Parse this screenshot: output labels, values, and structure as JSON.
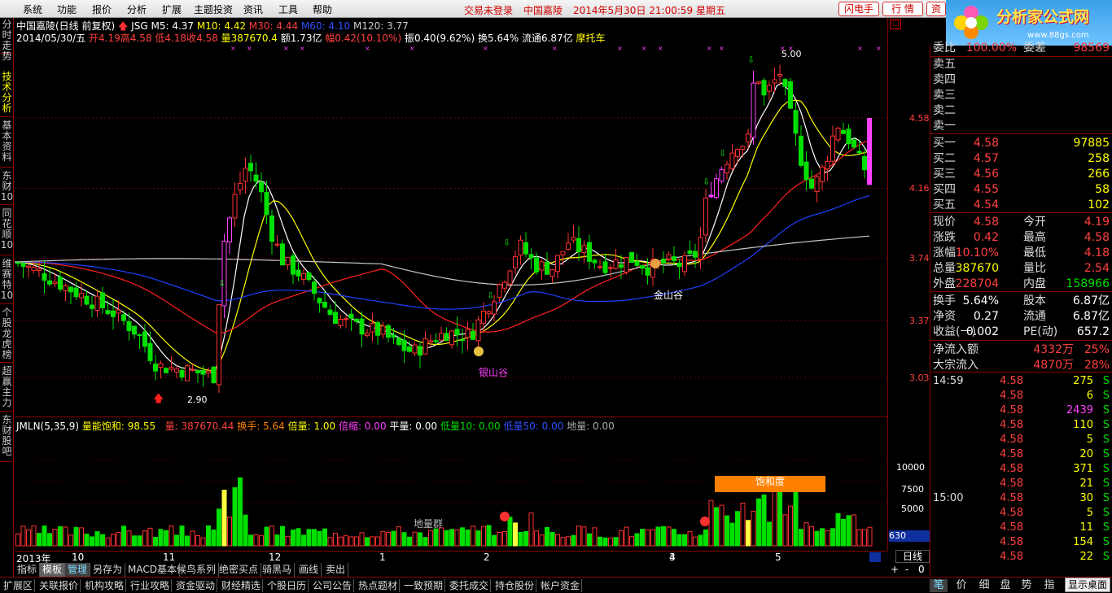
{
  "menu": {
    "items": [
      "系统",
      "功能",
      "报价",
      "分析",
      "扩展",
      "主题投资",
      "资讯",
      "工具",
      "帮助"
    ],
    "login_status": "交易未登录",
    "stock_name": "中国嘉陵",
    "datetime": "2014年5月30日 21:00:59 星期五",
    "btn_flash": "闪电手",
    "btn_quote": "行 情",
    "btn_zi": "资"
  },
  "logo": {
    "text": "分析家公式网",
    "url": "www.88gs.com"
  },
  "left_tabs": [
    "分时走势",
    "技术分析",
    "基本资料",
    "东财10",
    "同花顺10",
    "维赛特10",
    "个股龙虎榜",
    "超赢主力",
    "东财股吧"
  ],
  "header": {
    "line1_name": "中国嘉陵(日线 前复权)",
    "line1_code": "JSG",
    "ma5": "M5: 4.37",
    "ma10": "M10: 4.42",
    "ma30": "M30: 4.44",
    "ma60": "M60: 4.10",
    "ma120": "M120: 3.77",
    "line2_date": "2014/05/30/五",
    "line2_open": "开4.19",
    "line2_high": "高4.58",
    "line2_low": "低4.18",
    "line2_close": "收4.58",
    "line2_vol": "量387670.4",
    "line2_amt": "额1.73亿",
    "line2_chg": "幅0.42(10.10%)",
    "line2_amp": "振0.40(9.62%)",
    "line2_turn": "换5.64%",
    "line2_float": "流通6.87亿",
    "line2_concept": "摩托车"
  },
  "price_axis": [
    "4.58",
    "4.16",
    "3.74",
    "3.37",
    "3.03"
  ],
  "chart_labels": {
    "max_price": "5.00",
    "min_price": "2.90",
    "golden_valley": "金山谷",
    "silver_valley": "银山谷",
    "saturation": "饱和度",
    "ground_group": "地量群"
  },
  "vol_header": {
    "name": "JMLN(5,35,9)",
    "saturation": "量能饱和: 98.55",
    "vol": "量: 387670.44",
    "turn": "换手: 5.64",
    "beiliang": "倍量: 1.00",
    "beisuo": "倍缩: 0.00",
    "pingliang": "平量: 0.00",
    "diliang10": "低量10: 0.00",
    "diliang50": "低量50: 0.00",
    "diliang": "地量: 0.00"
  },
  "vol_axis": [
    "10000",
    "7500",
    "5000",
    "630"
  ],
  "x_axis": [
    "2013年",
    "10",
    "11",
    "12",
    "1",
    "2",
    "3",
    "4",
    "5"
  ],
  "bottom_tabs": [
    "指标",
    "模板",
    "管理",
    "另存为",
    "MACD基本",
    "候鸟系列",
    "绝密买点",
    "骑黑马",
    "画线",
    "卖出"
  ],
  "period": "日线",
  "period_ctrl": [
    "+",
    "-",
    "0"
  ],
  "bottom_bar": [
    "扩展区",
    "关联报价",
    "机构攻略",
    "行业攻略",
    "资金驱动",
    "财经精选",
    "个股日历",
    "公司公告",
    "热点题材",
    "一致预期",
    "委托成交",
    "持仓股份",
    "帐户资金"
  ],
  "right_bottom": [
    "笔",
    "价",
    "细",
    "盘",
    "势",
    "指"
  ],
  "desktop_btn": "显示桌面",
  "panel": {
    "wei_label": "委比",
    "wei_value": "100.00%",
    "wei_cha_label": "委差",
    "wei_cha_value": "98569",
    "sell": [
      {
        "label": "卖五"
      },
      {
        "label": "卖四"
      },
      {
        "label": "卖三"
      },
      {
        "label": "卖二"
      },
      {
        "label": "卖一"
      }
    ],
    "buy": [
      {
        "label": "买一",
        "price": "4.58",
        "vol": "97885"
      },
      {
        "label": "买二",
        "price": "4.57",
        "vol": "258"
      },
      {
        "label": "买三",
        "price": "4.56",
        "vol": "266"
      },
      {
        "label": "买四",
        "price": "4.55",
        "vol": "58"
      },
      {
        "label": "买五",
        "price": "4.54",
        "vol": "102"
      }
    ],
    "stats": [
      {
        "l1": "现价",
        "v1": "4.58",
        "l2": "今开",
        "v2": "4.19"
      },
      {
        "l1": "涨跌",
        "v1": "0.42",
        "l2": "最高",
        "v2": "4.58"
      },
      {
        "l1": "涨幅",
        "v1": "10.10%",
        "l2": "最低",
        "v2": "4.18"
      },
      {
        "l1": "总量",
        "v1": "387670",
        "l2": "量比",
        "v2": "2.54"
      },
      {
        "l1": "外盘",
        "v1": "228704",
        "l2": "内盘",
        "v2": "158966"
      }
    ],
    "stats2": [
      {
        "l1": "换手",
        "v1": "5.64%",
        "l2": "股本",
        "v2": "6.87亿"
      },
      {
        "l1": "净资",
        "v1": "0.27",
        "l2": "流通",
        "v2": "6.87亿"
      },
      {
        "l1": "收益(一)",
        "v1": "0.002",
        "l2": "PE(动)",
        "v2": "657.2"
      }
    ],
    "flow": [
      {
        "label": "净流入额",
        "v1": "4332万",
        "v2": "25%"
      },
      {
        "label": "大宗流入",
        "v1": "4870万",
        "v2": "28%"
      }
    ],
    "ticks": [
      {
        "time": "14:59",
        "price": "4.58",
        "vol": "275",
        "bs": "S"
      },
      {
        "time": "",
        "price": "4.58",
        "vol": "6",
        "bs": "S"
      },
      {
        "time": "",
        "price": "4.58",
        "vol": "2439",
        "bs": "S"
      },
      {
        "time": "",
        "price": "4.58",
        "vol": "110",
        "bs": "S"
      },
      {
        "time": "",
        "price": "4.58",
        "vol": "5",
        "bs": "S"
      },
      {
        "time": "",
        "price": "4.58",
        "vol": "20",
        "bs": "S"
      },
      {
        "time": "",
        "price": "4.58",
        "vol": "371",
        "bs": "S"
      },
      {
        "time": "",
        "price": "4.58",
        "vol": "21",
        "bs": "S"
      },
      {
        "time": "15:00",
        "price": "4.58",
        "vol": "30",
        "bs": "S"
      },
      {
        "time": "",
        "price": "4.58",
        "vol": "5",
        "bs": "S"
      },
      {
        "time": "",
        "price": "4.58",
        "vol": "11",
        "bs": "S"
      },
      {
        "time": "",
        "price": "4.58",
        "vol": "154",
        "bs": "S"
      },
      {
        "time": "",
        "price": "4.58",
        "vol": "22",
        "bs": "S"
      }
    ]
  },
  "colors": {
    "up": "#ff3030",
    "down": "#00e000",
    "limit_up": "#ff40ff",
    "ma5": "#ffffff",
    "ma10": "#ffff00",
    "ma30": "#ff2020",
    "ma60": "#2040ff",
    "ma120": "#c8c8c8"
  }
}
